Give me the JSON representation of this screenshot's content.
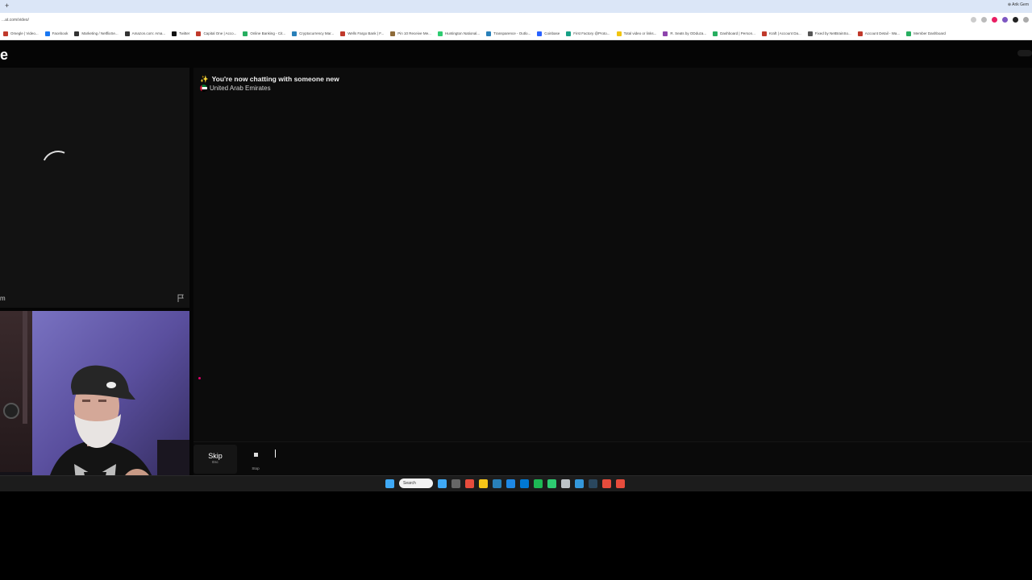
{
  "browser": {
    "url": "...at.com/video/",
    "bookmarks": [
      {
        "label": "Omegle | Video...",
        "color": "#c0392b"
      },
      {
        "label": "Facebook",
        "color": "#1877f2"
      },
      {
        "label": "Marketing / NetflixSe...",
        "color": "#333333"
      },
      {
        "label": "Amazon.com: Ama...",
        "color": "#333333"
      },
      {
        "label": "Twitter",
        "color": "#111111"
      },
      {
        "label": "Capital One | Acco...",
        "color": "#c0392b"
      },
      {
        "label": "Online Banking - Cit...",
        "color": "#27ae60"
      },
      {
        "label": "Cryptocurrency Mar...",
        "color": "#2980b9"
      },
      {
        "label": "Wells Fargo Bank | F...",
        "color": "#c0392b"
      },
      {
        "label": "Pin 10 Receive Me...",
        "color": "#8e6b3a"
      },
      {
        "label": "Huntington National...",
        "color": "#2ecc71"
      },
      {
        "label": "Transparence - Outlo...",
        "color": "#2980b9"
      },
      {
        "label": "Coinbase",
        "color": "#2962ff"
      },
      {
        "label": "First Factory @Proto...",
        "color": "#16a085"
      },
      {
        "label": "Total video or links...",
        "color": "#f1c40f"
      },
      {
        "label": "R. Seats by ODduza...",
        "color": "#8e44ad"
      },
      {
        "label": "Dashboard | Person...",
        "color": "#27ae60"
      },
      {
        "label": "Kraft | Account Da...",
        "color": "#c0392b"
      },
      {
        "label": "Fixed by NetBrainSo...",
        "color": "#555555"
      },
      {
        "label": "Account Detail - Wa...",
        "color": "#c0392b"
      },
      {
        "label": "Member Dashboard",
        "color": "#27ae60"
      }
    ]
  },
  "app": {
    "logo": "e",
    "video_tag": "m"
  },
  "chat": {
    "spark": "✨",
    "message": "You're now chatting with someone new",
    "country": "United Arab Emirates"
  },
  "controls": {
    "skip_label": "Skip",
    "skip_hint": "Esc",
    "stop_label": "Stop"
  },
  "taskbar": {
    "search_label": "Search",
    "icons": [
      "#3fa9f5",
      "#666666",
      "#e74c3c",
      "#f5c518",
      "#2980b9",
      "#1e88e5",
      "#0078d4",
      "#1db954",
      "#2ecc71",
      "#bdc3c7",
      "#3498db",
      "#2a475e",
      "#e74c3c",
      "#e74c3c"
    ]
  }
}
